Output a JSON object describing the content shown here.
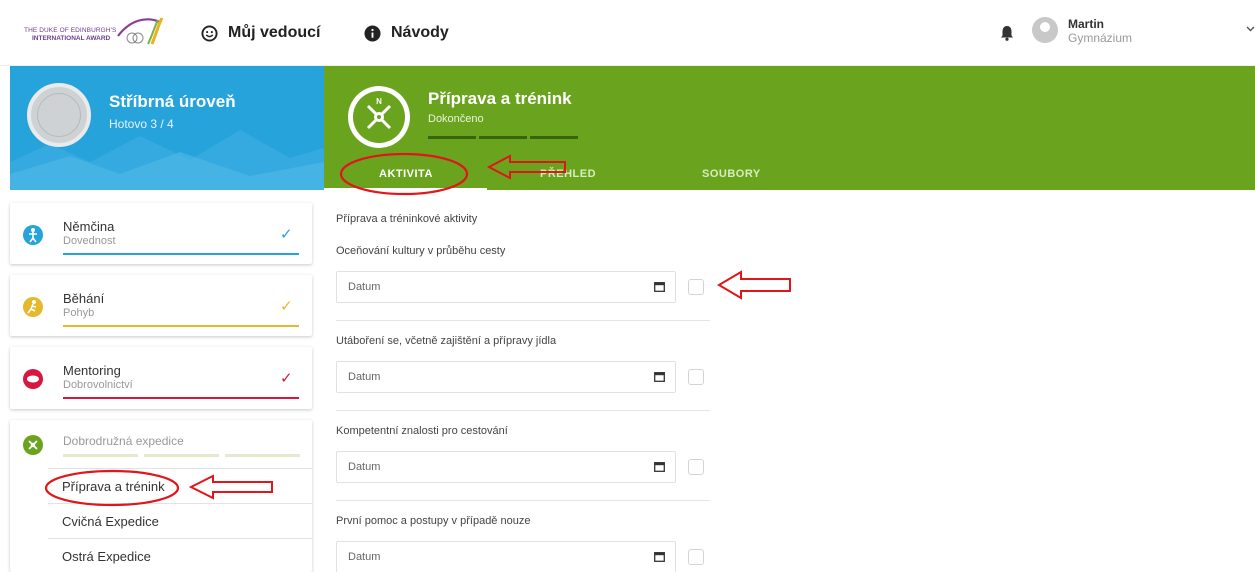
{
  "header": {
    "logo_line1": "THE DUKE OF EDINBURGH'S",
    "logo_line2": "INTERNATIONAL AWARD",
    "nav_mentor": "Můj vedoucí",
    "nav_guides": "Návody",
    "user_name": "Martin",
    "user_school": "Gymnázium"
  },
  "level": {
    "title": "Stříbrná úroveň",
    "progress": "Hotovo 3 / 4"
  },
  "section": {
    "title": "Příprava a trénink",
    "status": "Dokončeno",
    "tabs": [
      "AKTIVITA",
      "PŘEHLED",
      "SOUBORY"
    ]
  },
  "cards": [
    {
      "title": "Němčina",
      "subtitle": "Dovednost",
      "check": "✓",
      "color": "#27a3dc"
    },
    {
      "title": "Běhání",
      "subtitle": "Pohyb",
      "check": "✓",
      "color": "#e5b92b"
    },
    {
      "title": "Mentoring",
      "subtitle": "Dobrovolnictví",
      "check": "✓",
      "color": "#d7173f"
    },
    {
      "title": "Dobrodružná expedice",
      "color": "#6aa41f",
      "items": [
        "Příprava a trénink",
        "Cvičná Expedice",
        "Ostrá Expedice"
      ]
    }
  ],
  "form": {
    "heading": "Příprava a tréninkové aktivity",
    "fields": [
      {
        "label": "Oceňování kultury v průběhu cesty",
        "placeholder": "Datum"
      },
      {
        "label": "Utáboření se, včetně zajištění a přípravy jídla",
        "placeholder": "Datum"
      },
      {
        "label": "Kompetentní znalosti pro cestování",
        "placeholder": "Datum"
      },
      {
        "label": "První pomoc a postupy v případě nouze",
        "placeholder": "Datum"
      }
    ]
  },
  "colors": {
    "level_blue": "#27a3dc",
    "section_green": "#6aa41f",
    "annotation_red": "#e0161b"
  },
  "icons": [
    "smiley-icon",
    "info-icon",
    "bell-icon",
    "avatar-icon",
    "chevron-down-icon",
    "compass-icon",
    "calendar-icon",
    "check-icon",
    "medal-icon"
  ]
}
